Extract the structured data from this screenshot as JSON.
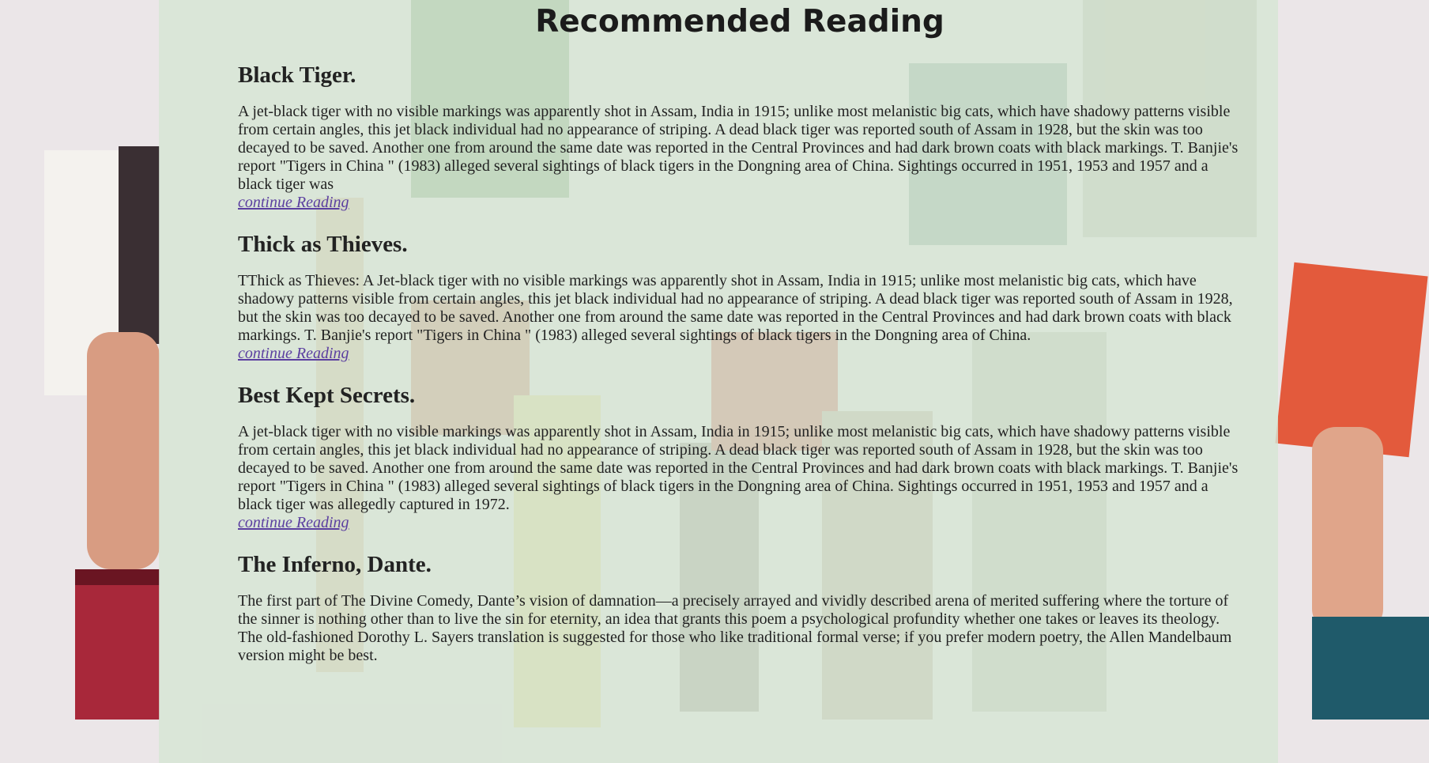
{
  "page": {
    "title": "Recommended Reading"
  },
  "articles": [
    {
      "title": "Black Tiger.",
      "body": "A jet-black tiger with no visible markings was apparently shot in Assam, India in 1915; unlike most melanistic big cats, which have shadowy patterns visible from certain angles, this jet black individual had no appearance of striping. A dead black tiger was reported south of Assam in 1928, but the skin was too decayed to be saved. Another one from around the same date was reported in the Central Provinces and had dark brown coats with black markings. T. Banjie's report \"Tigers in China \" (1983) alleged several sightings of black tigers in the Dongning area of China. Sightings occurred in 1951, 1953 and 1957 and a black tiger was",
      "link": "continue Reading"
    },
    {
      "title": "Thick as Thieves.",
      "body": "TThick as Thieves: A Jet-black tiger with no visible markings was apparently shot in Assam, India in 1915; unlike most melanistic big cats, which have shadowy patterns visible from certain angles, this jet black individual had no appearance of striping. A dead black tiger was reported south of Assam in 1928, but the skin was too decayed to be saved. Another one from around the same date was reported in the Central Provinces and had dark brown coats with black markings. T. Banjie's report \"Tigers in China \" (1983) alleged several sightings of black tigers in the Dongning area of China.",
      "link": "continue Reading"
    },
    {
      "title": "Best Kept Secrets.",
      "body": "A jet-black tiger with no visible markings was apparently shot in Assam, India in 1915; unlike most melanistic big cats, which have shadowy patterns visible from certain angles, this jet black individual had no appearance of striping. A dead black tiger was reported south of Assam in 1928, but the skin was too decayed to be saved. Another one from around the same date was reported in the Central Provinces and had dark brown coats with black markings. T. Banjie's report \"Tigers in China \" (1983) alleged several sightings of black tigers in the Dongning area of China. Sightings occurred in 1951, 1953 and 1957 and a black tiger was allegedly captured in 1972.",
      "link": "continue Reading"
    },
    {
      "title": "The Inferno, Dante.",
      "body": "The first part of The Divine Comedy, Dante’s vision of damnation—a precisely arrayed and vividly described arena of merited suffering where the torture of the sinner is nothing other than to live the sin for eternity, an idea that grants this poem a psychological profundity whether one takes or leaves its theology. The old-fashioned Dorothy L. Sayers translation is suggested for those who like traditional formal verse; if you prefer modern poetry, the Allen Mandelbaum version might be best."
    }
  ],
  "colors": {
    "panel": "#d6e5d4",
    "link": "#5b3fa0",
    "text": "#222222"
  }
}
